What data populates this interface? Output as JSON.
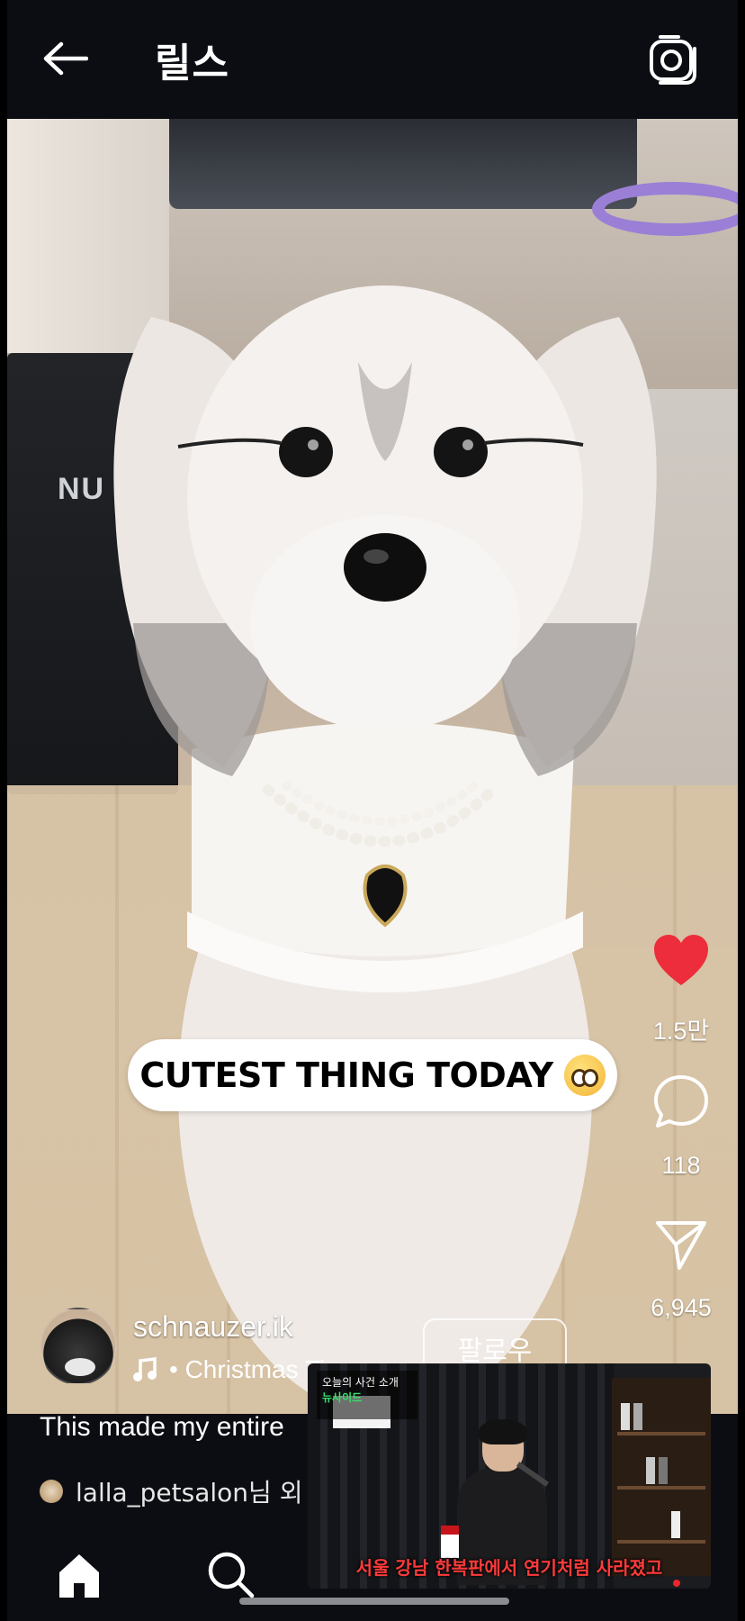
{
  "header": {
    "title": "릴스",
    "back_icon": "arrow-left-icon",
    "camera_icon": "camera-icon"
  },
  "video": {
    "amp_logo": "NU",
    "sticker_text": "CUTEST THING TODAY",
    "sticker_emoji": "pleading-face-emoji"
  },
  "actions": {
    "likes": "1.5만",
    "comments": "118",
    "shares": "6,945",
    "like_color": "#ed2d3b"
  },
  "author": {
    "username": "schnauzer.ik",
    "follow_label": "팔로우",
    "music_text": "• Christmas Ti"
  },
  "caption": {
    "text": "This made my entire"
  },
  "liked_by": {
    "text": "lalla_petsalon님 외"
  },
  "pip": {
    "badge_top": "오늘의 사건 소개",
    "badge_brand": "뉴사이드",
    "subtitle": "서울 강남 한복판에서 연기처럼 사라졌고"
  },
  "nav": {
    "home_icon": "home-icon",
    "search_icon": "search-icon"
  }
}
